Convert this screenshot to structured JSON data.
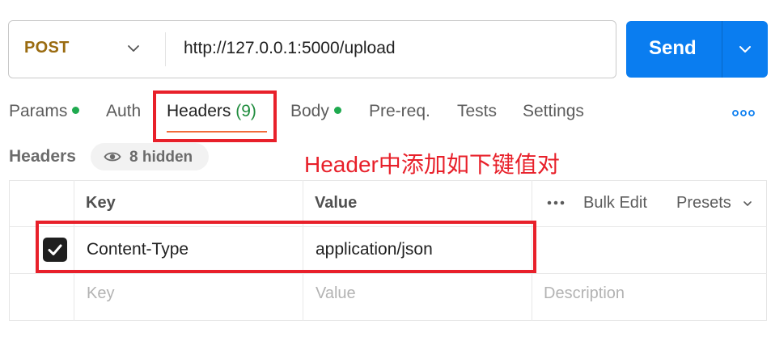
{
  "request": {
    "method": "POST",
    "url": "http://127.0.0.1:5000/upload",
    "send_label": "Send"
  },
  "tabs": [
    {
      "label": "Params",
      "has_dot": true
    },
    {
      "label": "Auth"
    },
    {
      "label": "Headers",
      "count": "(9)",
      "active": true
    },
    {
      "label": "Body",
      "has_dot": true
    },
    {
      "label": "Pre-req."
    },
    {
      "label": "Tests"
    },
    {
      "label": "Settings"
    }
  ],
  "headers_section": {
    "title": "Headers",
    "hidden_label": "8 hidden"
  },
  "annotation": "Header中添加如下键值对",
  "table": {
    "columns": {
      "key": "Key",
      "value": "Value"
    },
    "bulk_edit": "Bulk Edit",
    "presets": "Presets",
    "rows": [
      {
        "checked": true,
        "key": "Content-Type",
        "value": "application/json"
      }
    ],
    "placeholders": {
      "key": "Key",
      "value": "Value",
      "description": "Description"
    }
  },
  "colors": {
    "send": "#0a7df0",
    "method": "#9a6b10",
    "dot": "#1faa4f",
    "tab_underline": "#f26b3a",
    "annotation_red": "#e8202a"
  },
  "icons": {
    "method_dropdown": "chevron-down-icon",
    "send_dropdown": "chevron-down-icon",
    "more": "more-horizontal-icon",
    "hidden": "eye-icon",
    "bulk": "more-horizontal-icon",
    "presets": "chevron-down-icon",
    "checkbox": "checkmark-icon"
  }
}
